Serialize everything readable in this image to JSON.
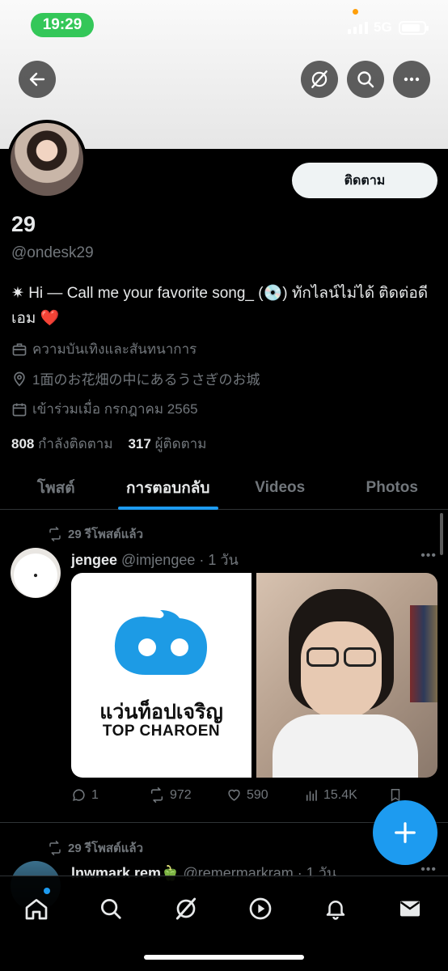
{
  "status": {
    "time": "19:29",
    "network": "5G",
    "battery_level": 0.75
  },
  "profile": {
    "follow_label": "ติดตาม",
    "name": "29",
    "handle": "@ondesk29",
    "bio": "✷ Hi — Call me your favorite song_ (💿) ทักไลน์ไม่ได้ ติดต่อดีเอม ❤️",
    "category": "ความบันเทิงและสันทนาการ",
    "location": "1面のお花畑の中にあるうさぎのお城",
    "joined": "เข้าร่วมเมื่อ กรกฎาคม 2565",
    "following_count": "808",
    "following_label": "กำลังติดตาม",
    "followers_count": "317",
    "followers_label": "ผู้ติดตาม"
  },
  "tabs": [
    {
      "label": "โพสต์"
    },
    {
      "label": "การตอบกลับ"
    },
    {
      "label": "Videos"
    },
    {
      "label": "Photos"
    }
  ],
  "posts": [
    {
      "repost_label": "29 รีโพสต์แล้ว",
      "username": "jengee",
      "handle_time": " @imjengee · 1 วัน",
      "media_text_th": "แว่นท็อปเจริญ",
      "media_text_en": "TOP CHAROEN",
      "replies": "1",
      "reposts": "972",
      "likes": "590",
      "views": "15.4K"
    },
    {
      "repost_label": "29 รีโพสต์แล้ว",
      "username": "lnwmark rem🫑",
      "handle_time": " @remermarkram · 1 วัน"
    }
  ],
  "icons": {
    "back": "arrow-left-icon",
    "grok": "grok-icon",
    "search": "search-icon",
    "more": "more-icon",
    "nav": [
      "home-icon",
      "search-icon",
      "grok-icon",
      "play-icon",
      "bell-icon",
      "mail-icon"
    ]
  },
  "colors": {
    "accent": "#1d9bf0",
    "status_pill": "#34c759",
    "background": "#000000",
    "muted": "#71767b"
  }
}
